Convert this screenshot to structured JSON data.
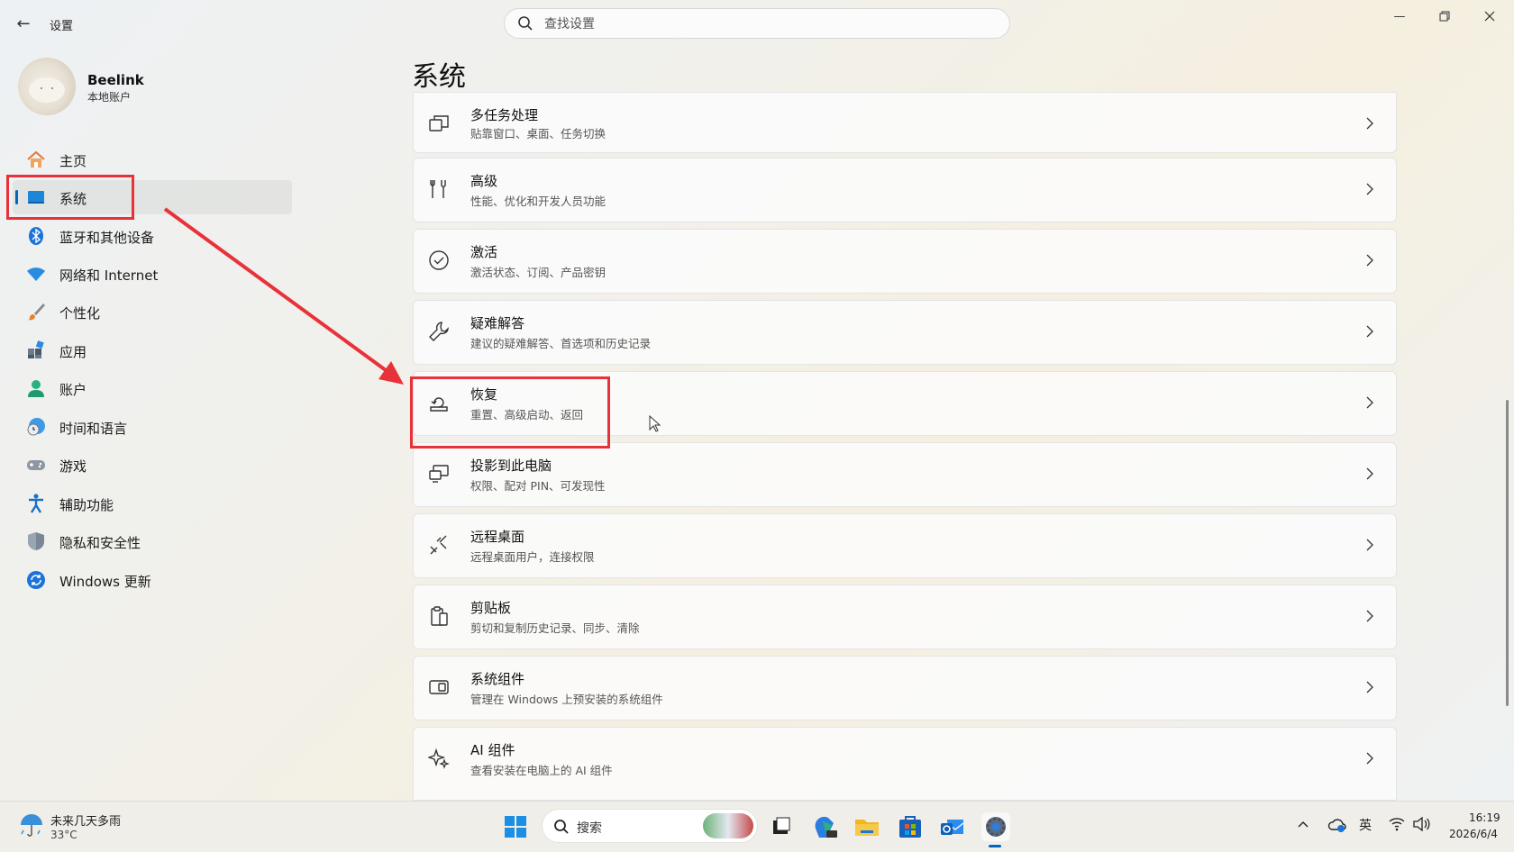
{
  "window": {
    "title": "设置",
    "search_placeholder": "查找设置"
  },
  "user": {
    "name": "Beelink",
    "account_type": "本地账户"
  },
  "sidebar": {
    "items": [
      {
        "label": "主页",
        "icon": "home-icon"
      },
      {
        "label": "系统",
        "icon": "system-icon",
        "active": true
      },
      {
        "label": "蓝牙和其他设备",
        "icon": "bluetooth-icon"
      },
      {
        "label": "网络和 Internet",
        "icon": "wifi-icon"
      },
      {
        "label": "个性化",
        "icon": "brush-icon"
      },
      {
        "label": "应用",
        "icon": "apps-icon"
      },
      {
        "label": "账户",
        "icon": "account-icon"
      },
      {
        "label": "时间和语言",
        "icon": "clock-globe-icon"
      },
      {
        "label": "游戏",
        "icon": "gamepad-icon"
      },
      {
        "label": "辅助功能",
        "icon": "accessibility-icon"
      },
      {
        "label": "隐私和安全性",
        "icon": "shield-icon"
      },
      {
        "label": "Windows 更新",
        "icon": "update-icon"
      }
    ]
  },
  "main": {
    "title": "系统",
    "cards": [
      {
        "title": "多任务处理",
        "subtitle": "贴靠窗口、桌面、任务切换",
        "icon": "multitasking-icon"
      },
      {
        "title": "高级",
        "subtitle": "性能、优化和开发人员功能",
        "icon": "advanced-tools-icon"
      },
      {
        "title": "激活",
        "subtitle": "激活状态、订阅、产品密钥",
        "icon": "activation-check-icon"
      },
      {
        "title": "疑难解答",
        "subtitle": "建议的疑难解答、首选项和历史记录",
        "icon": "wrench-icon"
      },
      {
        "title": "恢复",
        "subtitle": "重置、高级启动、返回",
        "icon": "recovery-icon"
      },
      {
        "title": "投影到此电脑",
        "subtitle": "权限、配对 PIN、可发现性",
        "icon": "project-icon"
      },
      {
        "title": "远程桌面",
        "subtitle": "远程桌面用户，连接权限",
        "icon": "remote-desktop-icon"
      },
      {
        "title": "剪贴板",
        "subtitle": "剪切和复制历史记录、同步、清除",
        "icon": "clipboard-icon"
      },
      {
        "title": "系统组件",
        "subtitle": "管理在 Windows 上预安装的系统组件",
        "icon": "components-icon"
      },
      {
        "title": "AI 组件",
        "subtitle": "查看安装在电脑上的 AI 组件",
        "icon": "sparkle-icon"
      }
    ]
  },
  "annotations": {
    "color": "#e8323a",
    "highlighted": [
      "系统",
      "恢复"
    ]
  },
  "taskbar": {
    "weather_text": "未来几天多雨",
    "weather_temp": "33°C",
    "search_label": "搜索",
    "input_indicator": "英",
    "time": "16:19",
    "date": "2026/6/4"
  },
  "colors": {
    "accent": "#0067c0"
  }
}
